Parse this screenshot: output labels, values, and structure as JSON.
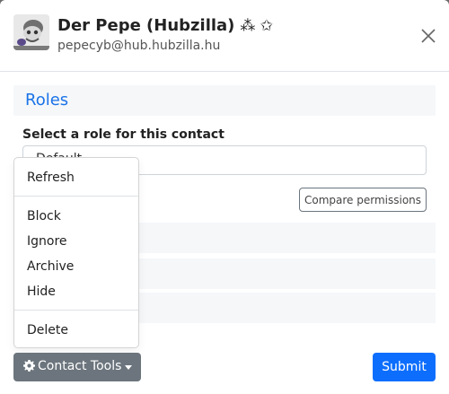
{
  "header": {
    "name": "Der Pepe (Hubzilla)",
    "stars": "⁂ ✩",
    "address": "pepecyb@hub.hubzilla.hu"
  },
  "roles": {
    "section_title": "Roles",
    "select_label": "Select a role for this contact",
    "selected_role": "Default",
    "compare_button": "Compare permissions"
  },
  "dropdown": {
    "items": [
      "Refresh",
      "Block",
      "Ignore",
      "Archive",
      "Hide",
      "Delete"
    ]
  },
  "footer": {
    "tools_label": "Contact Tools",
    "submit_label": "Submit"
  },
  "colors": {
    "accent": "#1a73e8",
    "submit": "#0d6efd",
    "secondary": "#6c757d"
  },
  "icons": [
    "close-icon",
    "gear-icon",
    "caret-down-icon",
    "avatar-image"
  ]
}
